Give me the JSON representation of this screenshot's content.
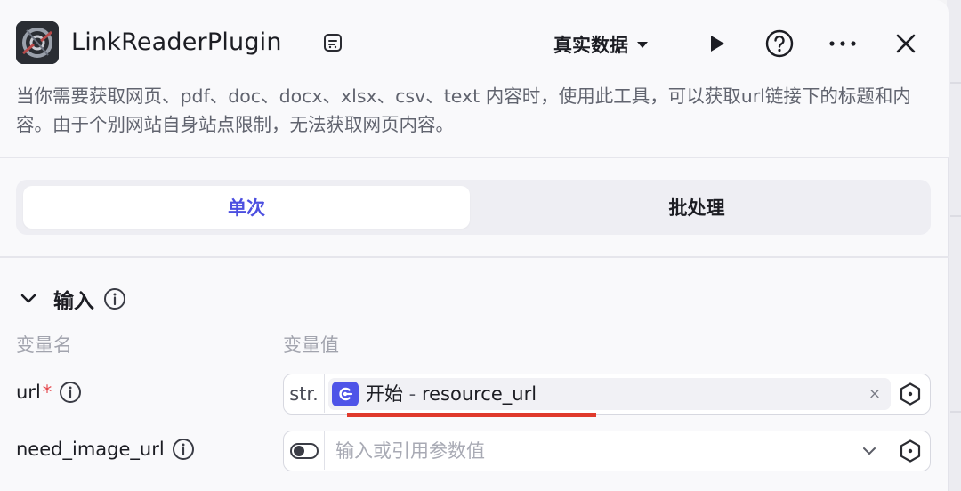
{
  "header": {
    "title": "LinkReaderPlugin",
    "data_mode_label": "真实数据",
    "description": "当你需要获取网页、pdf、doc、docx、xlsx、csv、text 内容时，使用此工具，可以获取url链接下的标题和内容。由于个别网站自身站点限制，无法获取网页内容。"
  },
  "tabs": [
    {
      "label": "单次",
      "active": true
    },
    {
      "label": "批处理",
      "active": false
    }
  ],
  "input_section": {
    "title": "输入",
    "col_name_header": "变量名",
    "col_value_header": "变量值",
    "params": [
      {
        "name": "url",
        "required_mark": "*",
        "type_prefix": "str.",
        "ref_node": "开始",
        "ref_separator": " - ",
        "ref_var": "resource_url",
        "clear_glyph": "×"
      },
      {
        "name": "need_image_url",
        "placeholder": "输入或引用参数值"
      }
    ]
  },
  "colors": {
    "accent": "#4c4fe0",
    "chip_icon_bg": "#4e54e8",
    "required": "#e5484d",
    "annotation_underline": "#e03a2c"
  },
  "icons": {
    "header": [
      "plugin-logo-icon",
      "copy-icon",
      "caret-down-icon",
      "play-icon",
      "help-icon",
      "more-icon",
      "close-icon"
    ],
    "fields": [
      "start-node-icon",
      "clear-icon",
      "hexagon-variable-icon",
      "toggle-icon",
      "chevron-down-icon"
    ]
  }
}
